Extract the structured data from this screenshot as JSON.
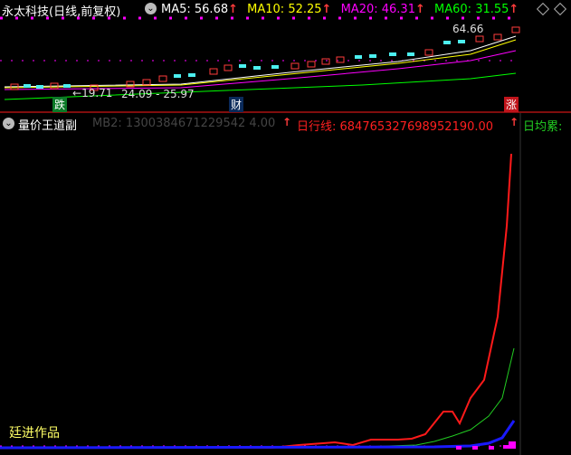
{
  "header": {
    "title": "永太科技(日线,前复权)",
    "ma": [
      {
        "label": "MA5: 56.68",
        "color": "#ffffff"
      },
      {
        "label": "MA10: 52.25",
        "color": "#ffff00"
      },
      {
        "label": "MA20: 46.31",
        "color": "#ff00ff"
      },
      {
        "label": "MA60: 31.55",
        "color": "#00ff00"
      }
    ],
    "arrow": "↑"
  },
  "price_panel": {
    "high_label": "64.66",
    "low_label": "19.71",
    "range_label": "24.09 - 25.97",
    "markers": [
      {
        "text": "跌",
        "bg": "#0b7a27",
        "fg": "#ffffff"
      },
      {
        "text": "财",
        "bg": "#0a2a5a",
        "fg": "#ffffff"
      },
      {
        "text": "涨",
        "bg": "#c0141b",
        "fg": "#ffffff"
      }
    ]
  },
  "indicator": {
    "title": "量价王道副",
    "mb2": "MB2: 1300384671229542 4.00",
    "daily_line_label": "日行线: 684765327698952190.00",
    "daily_avg_label": "日均累:",
    "watermark": "廷进作品"
  },
  "colors": {
    "red": "#ff1a1a",
    "green": "#22cc22",
    "blue": "#1a1aff",
    "magenta": "#ff00ff",
    "cyan": "#4cf0f0"
  },
  "icons": {
    "collapse": "chevron-circle-icon",
    "diamond": "diamond-icon"
  }
}
